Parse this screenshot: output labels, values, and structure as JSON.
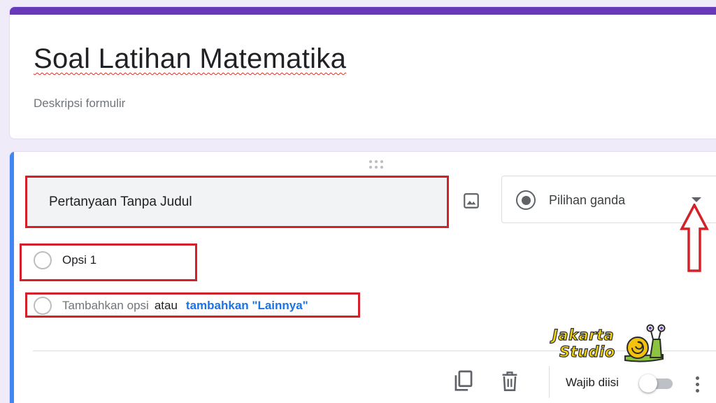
{
  "form": {
    "title": "Soal Latihan Matematika",
    "description_placeholder": "Deskripsi formulir"
  },
  "question": {
    "title_placeholder": "Pertanyaan Tanpa Judul",
    "type_label": "Pilihan ganda",
    "type_icon": "radio-button-icon",
    "options": [
      {
        "label": "Opsi 1"
      }
    ],
    "add_option_label": "Tambahkan opsi",
    "or_label": "atau",
    "add_other_label": "tambahkan \"Lainnya\""
  },
  "footer": {
    "required_label": "Wajib diisi",
    "required_enabled": false,
    "icons": [
      "copy-icon",
      "delete-icon",
      "more-vertical-icon"
    ]
  },
  "watermark": {
    "line1": "Jakarta",
    "line2": "Studio"
  },
  "colors": {
    "theme": "#673ab7",
    "background": "#f0ebf8",
    "focus_bar": "#4285f4",
    "link": "#1a73e8",
    "annotation": "#d32029"
  }
}
